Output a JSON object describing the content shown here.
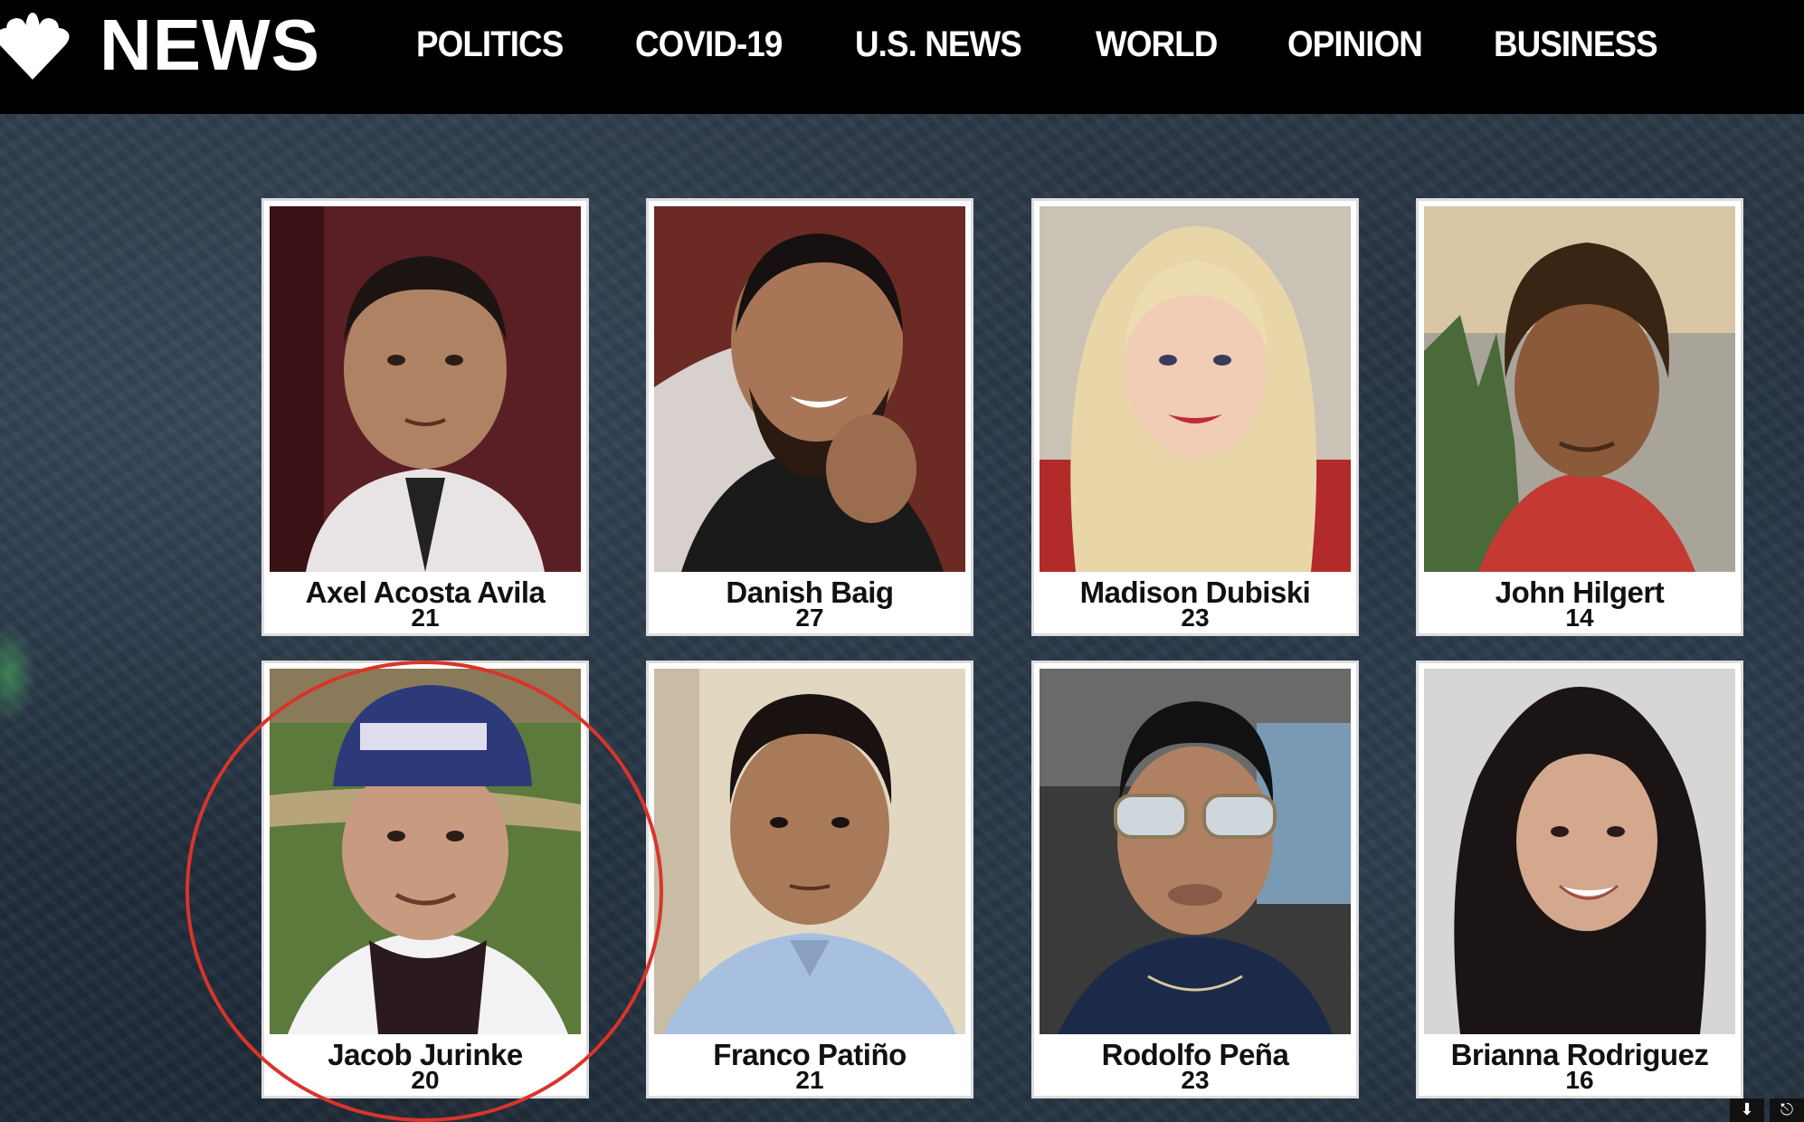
{
  "header": {
    "logo_text": "NEWS",
    "nav": [
      "POLITICS",
      "COVID-19",
      "U.S. NEWS",
      "WORLD",
      "OPINION",
      "BUSINESS"
    ]
  },
  "victims": [
    {
      "name": "Axel Acosta Avila",
      "age": "21"
    },
    {
      "name": "Danish Baig",
      "age": "27"
    },
    {
      "name": "Madison Dubiski",
      "age": "23"
    },
    {
      "name": "John Hilgert",
      "age": "14"
    },
    {
      "name": "Jacob Jurinke",
      "age": "20"
    },
    {
      "name": "Franco Patiño",
      "age": "21"
    },
    {
      "name": "Rodolfo Peña",
      "age": "23"
    },
    {
      "name": "Brianna Rodriguez",
      "age": "16"
    }
  ],
  "colors": {
    "header_bg": "#000000",
    "highlight": "#d9342b",
    "page_bg": "#243141"
  },
  "icons": {
    "logo": "nbc-peacock-icon",
    "corner": [
      "download-icon",
      "share-icon"
    ]
  }
}
